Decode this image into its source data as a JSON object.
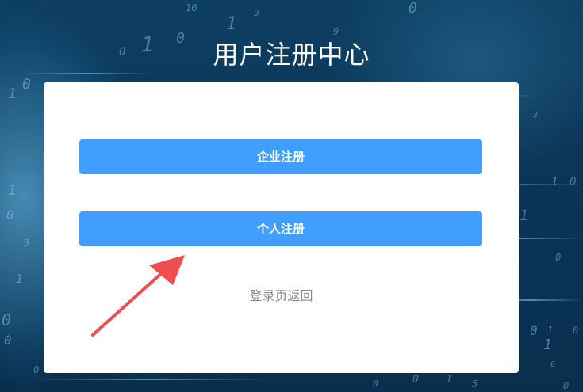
{
  "page": {
    "title": "用户注册中心"
  },
  "card": {
    "company_register_label": "企业注册",
    "personal_register_label": "个人注册",
    "back_to_login_label": "登录页返回"
  },
  "background": {
    "digits": [
      "10",
      "9",
      "0",
      "1",
      "0",
      "1",
      "0",
      "9",
      "3",
      "0",
      "1",
      "1",
      "0",
      "0",
      "1",
      "0",
      "6",
      "1",
      "0",
      "1",
      "0",
      "1",
      "0",
      "1",
      "0",
      "3",
      "0",
      "0",
      "5",
      "0",
      "1",
      "0"
    ]
  },
  "annotation": {
    "color": "#f04e4e",
    "icon": "red-arrow-icon"
  },
  "colors": {
    "button": "#409eff",
    "card": "#ffffff",
    "link": "#888888"
  }
}
